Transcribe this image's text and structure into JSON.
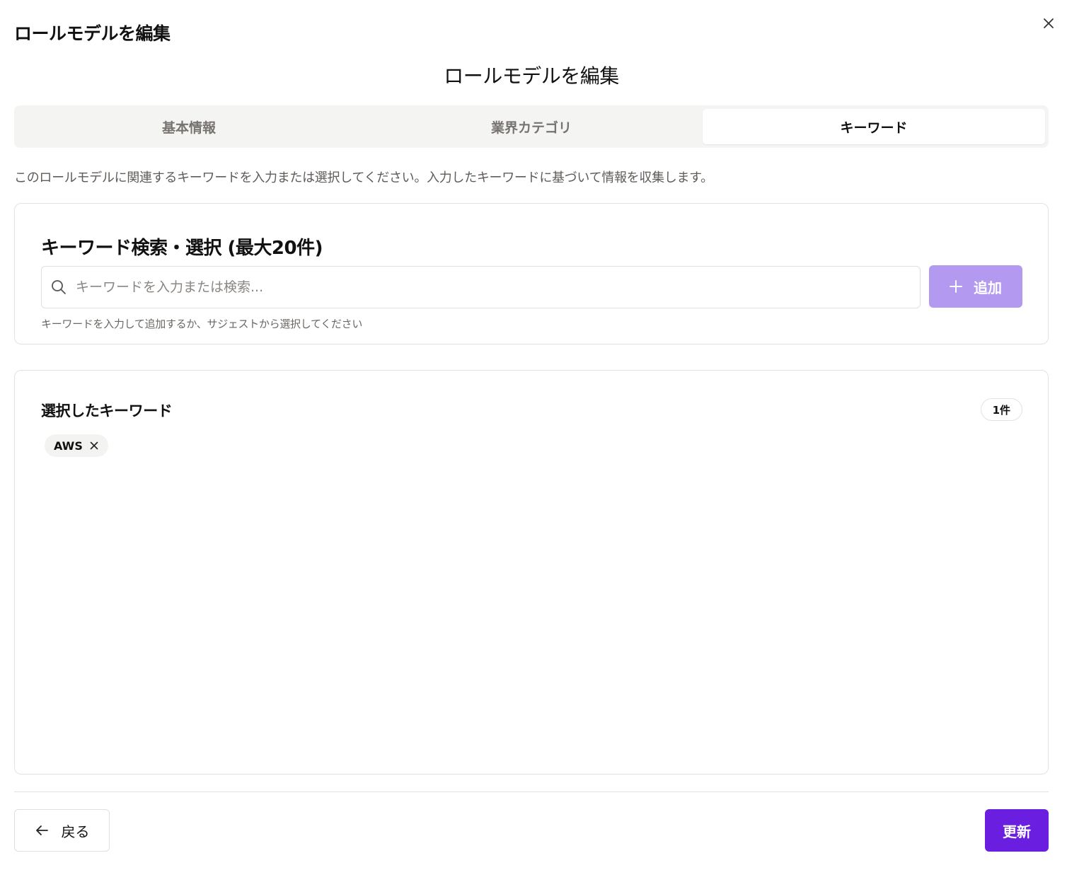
{
  "dialog": {
    "title": "ロールモデルを編集",
    "heading": "ロールモデルを編集"
  },
  "tabs": [
    {
      "label": "基本情報",
      "active": false
    },
    {
      "label": "業界カテゴリ",
      "active": false
    },
    {
      "label": "キーワード",
      "active": true
    }
  ],
  "description": "このロールモデルに関連するキーワードを入力または選択してください。入力したキーワードに基づいて情報を収集します。",
  "search": {
    "title": "キーワード検索・選択 (最大20件)",
    "placeholder": "キーワードを入力または検索...",
    "value": "",
    "add_label": "追加",
    "helper": "キーワードを入力して追加するか、サジェストから選択してください"
  },
  "selected": {
    "title": "選択したキーワード",
    "count": "1件",
    "keywords": [
      "AWS"
    ]
  },
  "footer": {
    "back_label": "戻る",
    "update_label": "更新"
  },
  "icons": {
    "close": "close-icon",
    "search": "search-icon",
    "plus": "plus-icon",
    "chip_remove": "close-icon",
    "back": "arrow-left-icon"
  },
  "colors": {
    "primary": "#6a1fe0",
    "primary_disabled": "#b39af0",
    "tab_background": "#f4f4f3",
    "border": "#e3e2e0"
  }
}
